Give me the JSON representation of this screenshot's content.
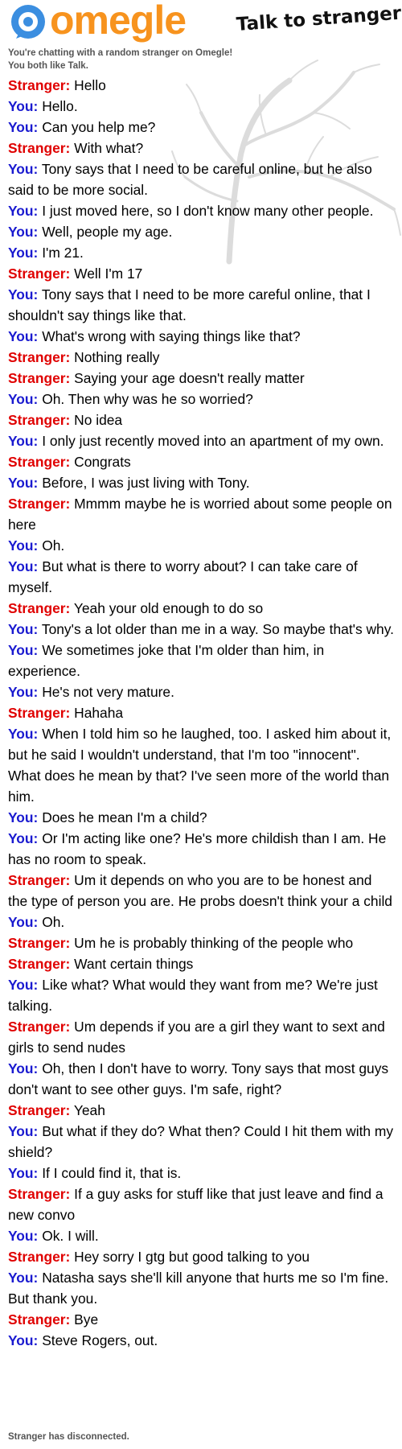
{
  "header": {
    "logo_text": "omegle",
    "tagline": "Talk to strangers!",
    "brand_orange": "#f7931e",
    "brand_blue": "#3b8ee0"
  },
  "info": {
    "line1": "You're chatting with a random stranger on Omegle!",
    "line2": "You both like Talk."
  },
  "colors": {
    "stranger": "#e00000",
    "you": "#1a1ad0"
  },
  "messages": [
    {
      "sender": "Stranger:",
      "text": "Hello"
    },
    {
      "sender": "You:",
      "text": "Hello."
    },
    {
      "sender": "You:",
      "text": "Can you help me?"
    },
    {
      "sender": "Stranger:",
      "text": "With what?"
    },
    {
      "sender": "You:",
      "text": "Tony says that I need to be careful online, but he also said to be more social."
    },
    {
      "sender": "You:",
      "text": "I just moved here, so I don't know many other people."
    },
    {
      "sender": "You:",
      "text": "Well, people my age."
    },
    {
      "sender": "You:",
      "text": "I'm 21."
    },
    {
      "sender": "Stranger:",
      "text": "Well I'm 17"
    },
    {
      "sender": "You:",
      "text": "Tony says that I need to be more careful online, that I shouldn't say things like that."
    },
    {
      "sender": "You:",
      "text": "What's wrong with saying things like that?"
    },
    {
      "sender": "Stranger:",
      "text": "Nothing really"
    },
    {
      "sender": "Stranger:",
      "text": "Saying your age doesn't really matter"
    },
    {
      "sender": "You:",
      "text": "Oh. Then why was he so worried?"
    },
    {
      "sender": "Stranger:",
      "text": "No idea"
    },
    {
      "sender": "You:",
      "text": "I only just recently moved into an apartment of my own."
    },
    {
      "sender": "Stranger:",
      "text": "Congrats"
    },
    {
      "sender": "You:",
      "text": "Before, I was just living with Tony."
    },
    {
      "sender": "Stranger:",
      "text": "Mmmm maybe he is worried about some people on here"
    },
    {
      "sender": "You:",
      "text": "Oh."
    },
    {
      "sender": "You:",
      "text": "But what is there to worry about? I can take care of myself."
    },
    {
      "sender": "Stranger:",
      "text": "Yeah your old enough to do so"
    },
    {
      "sender": "You:",
      "text": "Tony's a lot older than me in a way. So maybe that's why."
    },
    {
      "sender": "You:",
      "text": "We sometimes joke that I'm older than him, in experience."
    },
    {
      "sender": "You:",
      "text": "He's not very mature."
    },
    {
      "sender": "Stranger:",
      "text": "Hahaha"
    },
    {
      "sender": "You:",
      "text": "When I told him so he laughed, too. I asked him about it, but he said I wouldn't understand, that I'm too \"innocent\". What does he mean by that? I've seen more of the world than him."
    },
    {
      "sender": "You:",
      "text": "Does he mean I'm a child?"
    },
    {
      "sender": "You:",
      "text": "Or I'm acting like one? He's more childish than I am. He has no room to speak."
    },
    {
      "sender": "Stranger:",
      "text": "Um it depends on who you are to be honest and the type of person you are.  He probs doesn't think your a child"
    },
    {
      "sender": "You:",
      "text": "Oh."
    },
    {
      "sender": "Stranger:",
      "text": "Um he is probably thinking of the people who"
    },
    {
      "sender": "Stranger:",
      "text": "Want certain things"
    },
    {
      "sender": "You:",
      "text": "Like what? What would they want from me? We're just talking."
    },
    {
      "sender": "Stranger:",
      "text": "Um depends if you are a girl they want to sext and girls to send nudes"
    },
    {
      "sender": "You:",
      "text": "Oh, then I don't have to worry. Tony says that most guys don't want to see other guys. I'm safe, right?"
    },
    {
      "sender": "Stranger:",
      "text": "Yeah"
    },
    {
      "sender": "You:",
      "text": "But what if they do? What then? Could I hit them with my shield?"
    },
    {
      "sender": "You:",
      "text": "If I could find it, that is."
    },
    {
      "sender": "Stranger:",
      "text": "If a guy asks for stuff like that just leave and find a new convo"
    },
    {
      "sender": "You:",
      "text": "Ok. I will."
    },
    {
      "sender": "Stranger:",
      "text": "Hey sorry I gtg but good talking to you"
    },
    {
      "sender": "You:",
      "text": "Natasha says she'll kill anyone that hurts me so I'm fine. But thank you."
    },
    {
      "sender": "Stranger:",
      "text": "Bye"
    },
    {
      "sender": "You:",
      "text": "Steve Rogers, out."
    }
  ],
  "status": "Stranger has disconnected."
}
